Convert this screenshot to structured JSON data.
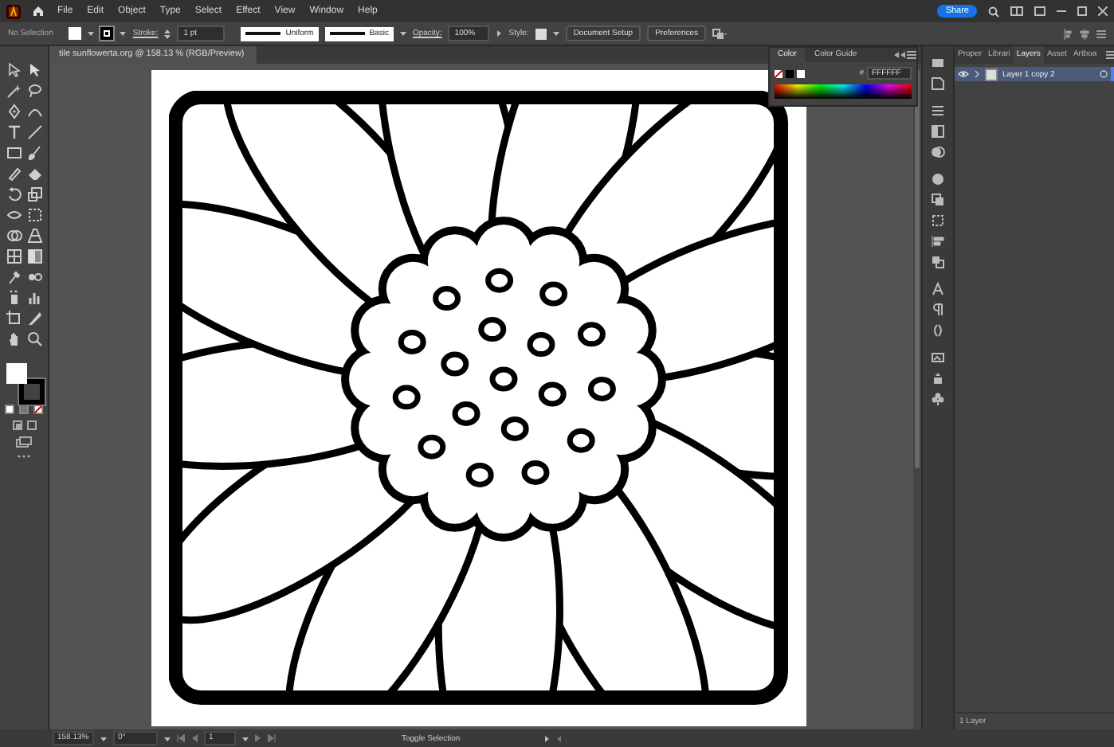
{
  "app_bar": {
    "menus": [
      "File",
      "Edit",
      "Object",
      "Type",
      "Select",
      "Effect",
      "View",
      "Window",
      "Help"
    ],
    "share_button": "Share"
  },
  "control_bar": {
    "selection": "No Selection",
    "stroke_label": "Stroke:",
    "stroke_weight": "1 pt",
    "profile": "Uniform",
    "brush": "Basic",
    "opacity_label": "Opacity:",
    "opacity": "100%",
    "style_label": "Style:",
    "buttons": [
      "Document Setup",
      "Preferences"
    ]
  },
  "document_tab": {
    "title": "tile sunflowerta.org @ 158.13 % (RGB/Preview)"
  },
  "color_panel": {
    "tabs": [
      {
        "label": "Color",
        "selected": true
      },
      {
        "label": "Color Guide",
        "selected": false
      }
    ],
    "hex_label": "#",
    "hex": "FFFFFF"
  },
  "layers_panel": {
    "tabs": [
      {
        "label": "Proper",
        "selected": false
      },
      {
        "label": "Librari",
        "selected": false
      },
      {
        "label": "Layers",
        "selected": true
      },
      {
        "label": "Asset",
        "selected": false
      },
      {
        "label": "Artboa",
        "selected": false
      }
    ],
    "layers": [
      {
        "name": "Layer 1 copy 2",
        "visible": true,
        "selected": true
      }
    ],
    "footer": "1 Layer"
  },
  "status_bar": {
    "zoom": "158.13%",
    "rotation": "0°",
    "artboard": "1",
    "mode": "Toggle Selection"
  }
}
